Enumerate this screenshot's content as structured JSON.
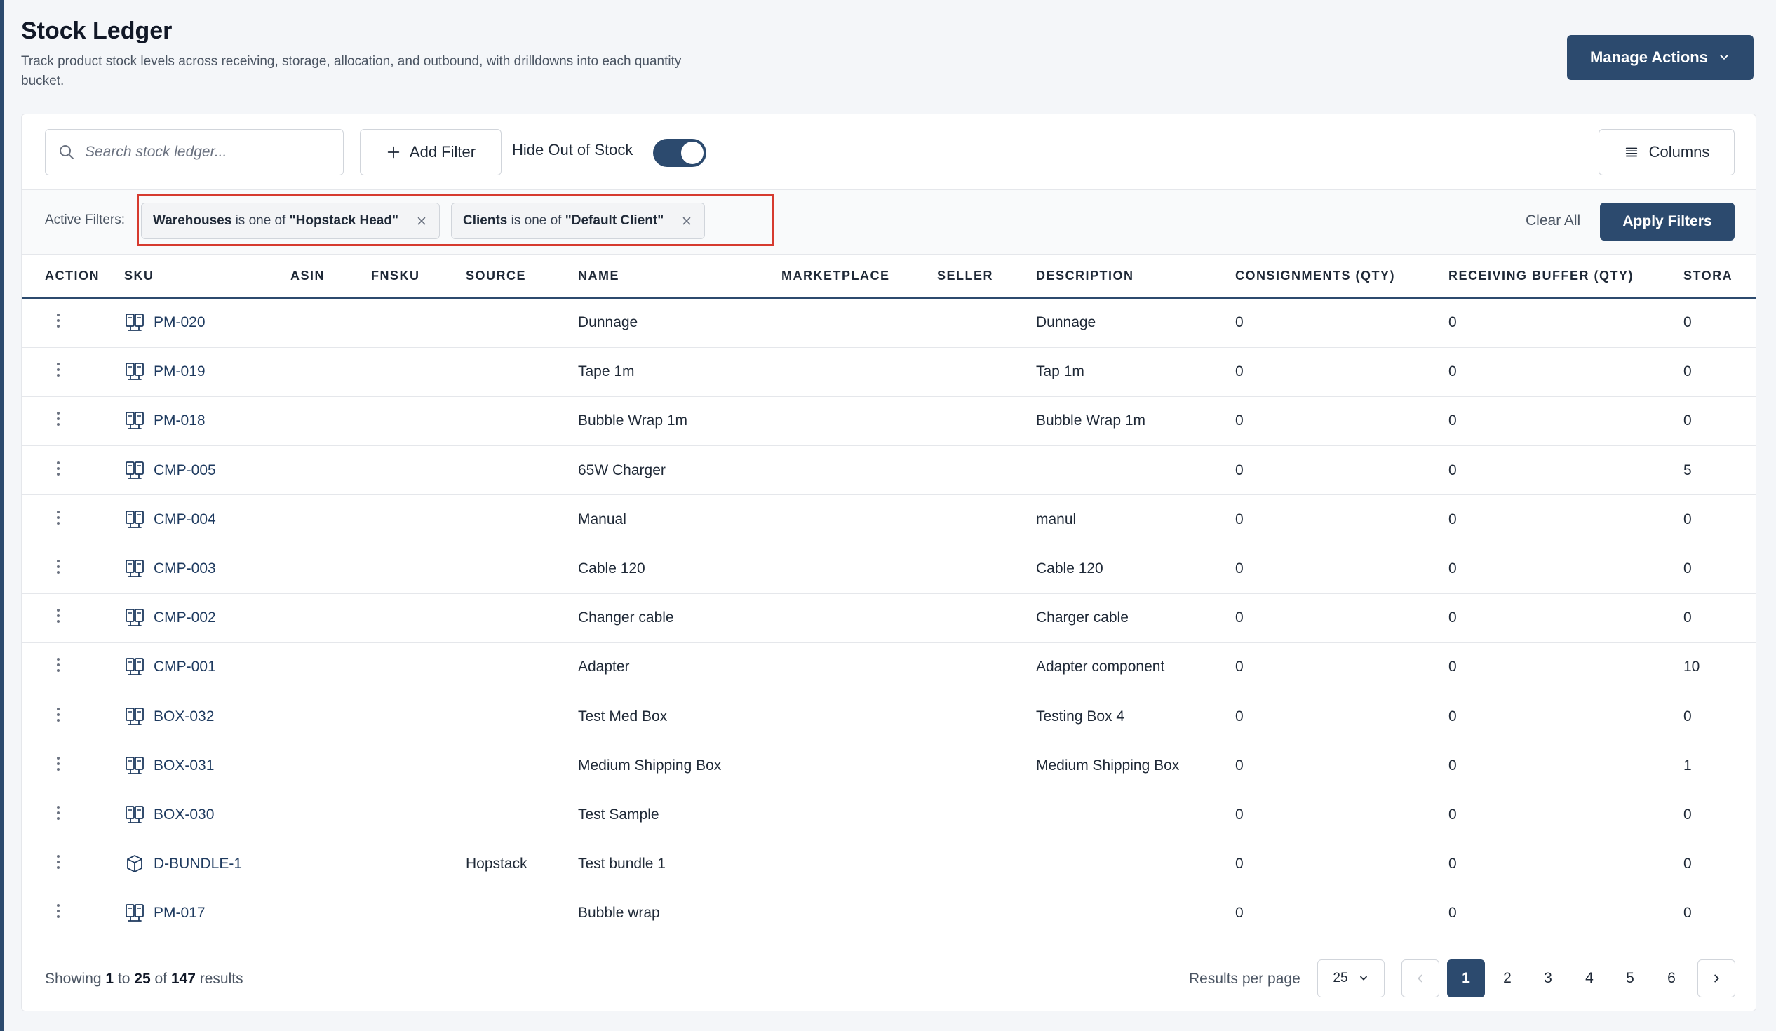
{
  "header": {
    "title": "Stock Ledger",
    "subtitle": "Track product stock levels across receiving, storage, allocation, and outbound, with drilldowns into each quantity bucket.",
    "manage_actions_label": "Manage Actions"
  },
  "toolbar": {
    "search_placeholder": "Search stock ledger...",
    "add_filter_label": "Add Filter",
    "hide_out_of_stock_label": "Hide Out of Stock",
    "hide_out_of_stock_on": true,
    "columns_label": "Columns"
  },
  "filters": {
    "label": "Active Filters:",
    "chips": [
      {
        "field": "Warehouses",
        "op": "is one of",
        "value": "\"Hopstack Head\""
      },
      {
        "field": "Clients",
        "op": "is one of",
        "value": "\"Default Client\""
      }
    ],
    "clear_all_label": "Clear All",
    "apply_label": "Apply Filters"
  },
  "table": {
    "headers": [
      "ACTION",
      "SKU",
      "ASIN",
      "FNSKU",
      "SOURCE",
      "NAME",
      "MARKETPLACE",
      "SELLER",
      "DESCRIPTION",
      "CONSIGNMENTS (QTY)",
      "RECEIVING BUFFER (QTY)",
      "STORA"
    ],
    "rows": [
      {
        "sku": "PM-020",
        "icon": "product-icon",
        "asin": "",
        "fnsku": "",
        "source": "",
        "name": "Dunnage",
        "marketplace": "",
        "seller": "",
        "description": "Dunnage",
        "consignments": "0",
        "receiving": "0",
        "storage": "0"
      },
      {
        "sku": "PM-019",
        "icon": "product-icon",
        "asin": "",
        "fnsku": "",
        "source": "",
        "name": "Tape 1m",
        "marketplace": "",
        "seller": "",
        "description": "Tap 1m",
        "consignments": "0",
        "receiving": "0",
        "storage": "0"
      },
      {
        "sku": "PM-018",
        "icon": "product-icon",
        "asin": "",
        "fnsku": "",
        "source": "",
        "name": "Bubble Wrap 1m",
        "marketplace": "",
        "seller": "",
        "description": "Bubble Wrap 1m",
        "consignments": "0",
        "receiving": "0",
        "storage": "0"
      },
      {
        "sku": "CMP-005",
        "icon": "product-icon",
        "asin": "",
        "fnsku": "",
        "source": "",
        "name": "65W Charger",
        "marketplace": "",
        "seller": "",
        "description": "",
        "consignments": "0",
        "receiving": "0",
        "storage": "5"
      },
      {
        "sku": "CMP-004",
        "icon": "product-icon",
        "asin": "",
        "fnsku": "",
        "source": "",
        "name": "Manual",
        "marketplace": "",
        "seller": "",
        "description": "manul",
        "consignments": "0",
        "receiving": "0",
        "storage": "0"
      },
      {
        "sku": "CMP-003",
        "icon": "product-icon",
        "asin": "",
        "fnsku": "",
        "source": "",
        "name": "Cable 120",
        "marketplace": "",
        "seller": "",
        "description": "Cable 120",
        "consignments": "0",
        "receiving": "0",
        "storage": "0"
      },
      {
        "sku": "CMP-002",
        "icon": "product-icon",
        "asin": "",
        "fnsku": "",
        "source": "",
        "name": "Changer cable",
        "marketplace": "",
        "seller": "",
        "description": "Charger cable",
        "consignments": "0",
        "receiving": "0",
        "storage": "0"
      },
      {
        "sku": "CMP-001",
        "icon": "product-icon",
        "asin": "",
        "fnsku": "",
        "source": "",
        "name": "Adapter",
        "marketplace": "",
        "seller": "",
        "description": "Adapter component",
        "consignments": "0",
        "receiving": "0",
        "storage": "10"
      },
      {
        "sku": "BOX-032",
        "icon": "product-icon",
        "asin": "",
        "fnsku": "",
        "source": "",
        "name": "Test Med Box",
        "marketplace": "",
        "seller": "",
        "description": "Testing Box 4",
        "consignments": "0",
        "receiving": "0",
        "storage": "0"
      },
      {
        "sku": "BOX-031",
        "icon": "product-icon",
        "asin": "",
        "fnsku": "",
        "source": "",
        "name": "Medium Shipping Box",
        "marketplace": "",
        "seller": "",
        "description": "Medium Shipping Box",
        "consignments": "0",
        "receiving": "0",
        "storage": "1"
      },
      {
        "sku": "BOX-030",
        "icon": "product-icon",
        "asin": "",
        "fnsku": "",
        "source": "",
        "name": "Test Sample",
        "marketplace": "",
        "seller": "",
        "description": "",
        "consignments": "0",
        "receiving": "0",
        "storage": "0"
      },
      {
        "sku": "D-BUNDLE-1",
        "icon": "bundle-icon",
        "asin": "",
        "fnsku": "",
        "source": "Hopstack",
        "name": "Test bundle 1",
        "marketplace": "",
        "seller": "",
        "description": "",
        "consignments": "0",
        "receiving": "0",
        "storage": "0"
      },
      {
        "sku": "PM-017",
        "icon": "product-icon",
        "asin": "",
        "fnsku": "",
        "source": "",
        "name": "Bubble wrap",
        "marketplace": "",
        "seller": "",
        "description": "",
        "consignments": "0",
        "receiving": "0",
        "storage": "0"
      }
    ]
  },
  "footer": {
    "showing_prefix": "Showing",
    "from": "1",
    "to_word": "to",
    "to": "25",
    "of_word": "of",
    "total": "147",
    "results_word": "results",
    "results_per_page_label": "Results per page",
    "per_page": "25",
    "pages": [
      "1",
      "2",
      "3",
      "4",
      "5",
      "6"
    ],
    "current_page": "1"
  },
  "colors": {
    "primary": "#2c4a6e",
    "highlight": "#d63a2f"
  }
}
